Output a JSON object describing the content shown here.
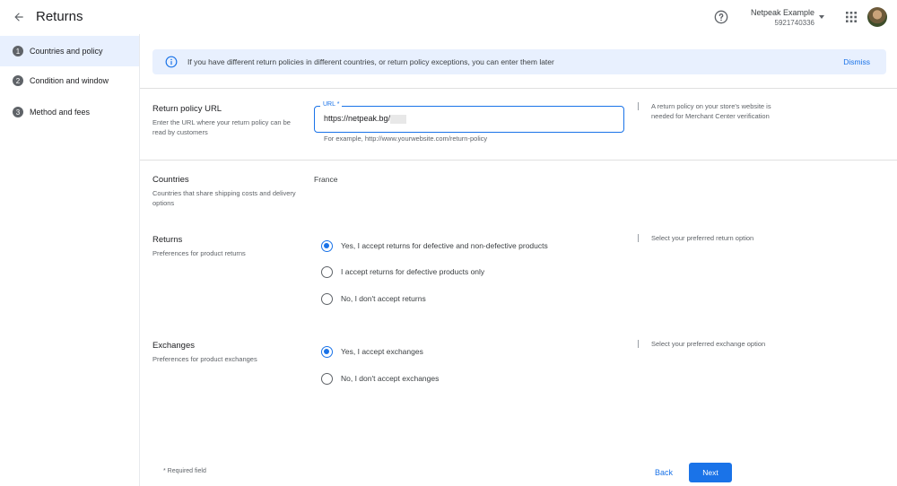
{
  "header": {
    "title": "Returns",
    "account_name": "Netpeak Example",
    "account_id": "5921740336"
  },
  "sidebar": {
    "steps": [
      {
        "number": "1",
        "label": "Countries and policy"
      },
      {
        "number": "2",
        "label": "Condition and window"
      },
      {
        "number": "3",
        "label": "Method and fees"
      }
    ]
  },
  "banner": {
    "text": "If you have different return policies in different countries, or return policy exceptions, you can enter them later",
    "dismiss_label": "Dismiss"
  },
  "return_policy": {
    "title": "Return policy URL",
    "description": "Enter the URL where your return policy can be read by customers",
    "field_label": "URL *",
    "field_value": "https://netpeak.bg/",
    "example": "For example, http://www.yourwebsite.com/return-policy",
    "hint": "A return policy on your store's website is needed for Merchant Center verification"
  },
  "countries": {
    "title": "Countries",
    "description": "Countries that share shipping costs and delivery options",
    "value": "France"
  },
  "returns": {
    "title": "Returns",
    "description": "Preferences for product returns",
    "hint": "Select your preferred return option",
    "options": [
      {
        "label": "Yes, I accept returns for defective and non-defective products",
        "checked": true
      },
      {
        "label": "I accept returns for defective products only",
        "checked": false
      },
      {
        "label": "No, I don't accept returns",
        "checked": false
      }
    ]
  },
  "exchanges": {
    "title": "Exchanges",
    "description": "Preferences for product exchanges",
    "hint": "Select your preferred exchange option",
    "options": [
      {
        "label": "Yes, I accept exchanges",
        "checked": true
      },
      {
        "label": "No, I don't accept exchanges",
        "checked": false
      }
    ]
  },
  "footer": {
    "required_note": "* Required field",
    "back_label": "Back",
    "next_label": "Next"
  },
  "colors": {
    "accent": "#1a73e8",
    "banner_bg": "#e8f0fe",
    "active_step_bg": "#e8f0fe"
  }
}
